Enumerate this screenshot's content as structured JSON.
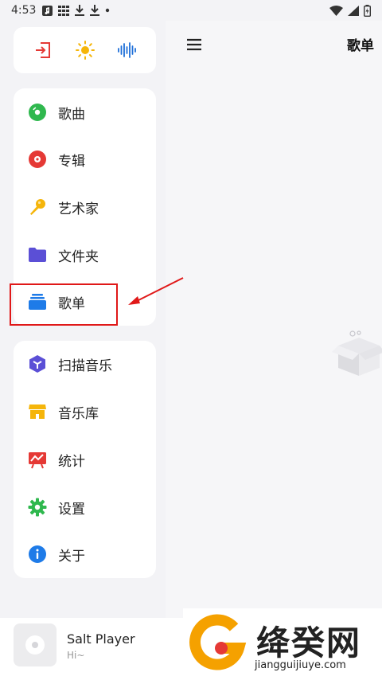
{
  "status_bar": {
    "time": "4:53"
  },
  "topbar": {
    "title": "歌单"
  },
  "quick_actions": [
    {
      "name": "exit-icon",
      "color": "#e53935"
    },
    {
      "name": "sun-icon",
      "color": "#f5b50a"
    },
    {
      "name": "equalizer-icon",
      "color": "#1e6fd9"
    }
  ],
  "nav_primary": [
    {
      "label": "歌曲",
      "icon": "song-disc-icon",
      "color": "#2fb84e"
    },
    {
      "label": "专辑",
      "icon": "album-disc-icon",
      "color": "#e53935"
    },
    {
      "label": "艺术家",
      "icon": "microphone-icon",
      "color": "#f5b50a"
    },
    {
      "label": "文件夹",
      "icon": "folder-icon",
      "color": "#5b4fd6"
    },
    {
      "label": "歌单",
      "icon": "playlist-icon",
      "color": "#1e7be8"
    }
  ],
  "nav_secondary": [
    {
      "label": "扫描音乐",
      "icon": "scan-icon",
      "color": "#5b4fd6"
    },
    {
      "label": "音乐库",
      "icon": "store-icon",
      "color": "#f5b50a"
    },
    {
      "label": "统计",
      "icon": "stats-icon",
      "color": "#e53935"
    },
    {
      "label": "设置",
      "icon": "gear-icon",
      "color": "#2fb84e"
    },
    {
      "label": "关于",
      "icon": "info-icon",
      "color": "#1e7be8"
    }
  ],
  "player": {
    "title": "Salt Player",
    "subtitle": "Hi~"
  },
  "watermark": {
    "text": "绛癸网",
    "url": "jiangguijiuye.com"
  }
}
